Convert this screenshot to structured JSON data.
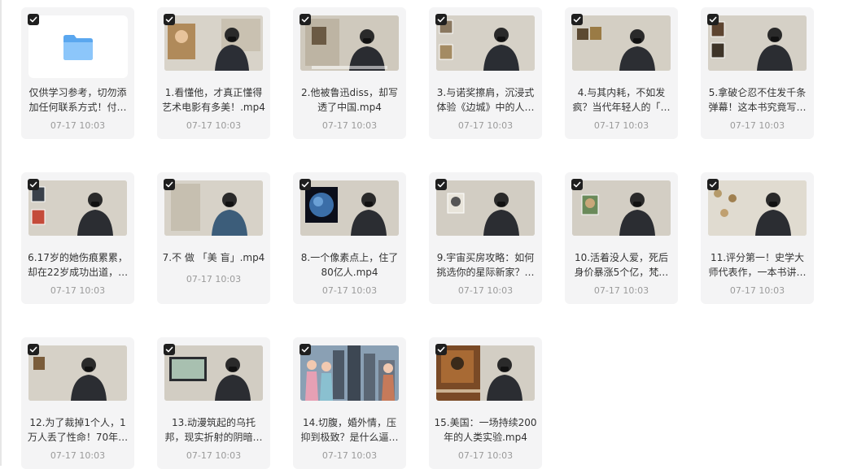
{
  "colors": {
    "card_bg": "#f4f4f5",
    "title": "#333333",
    "time": "#9a9a9a",
    "checkbox": "#1f1f1f",
    "folder": "#6db4f5"
  },
  "files": [
    {
      "kind": "folder",
      "title": "仅供学习参考，切勿添加任何联系方式！付…",
      "time": "07-17 10:03",
      "selected": true,
      "icon": "folder-icon"
    },
    {
      "kind": "video",
      "title": "1.看懂他，才真正懂得艺术电影有多美！.mp4",
      "time": "07-17 10:03",
      "selected": true
    },
    {
      "kind": "video",
      "title": "2.他被鲁迅diss，却写透了中国.mp4",
      "time": "07-17 10:03",
      "selected": true
    },
    {
      "kind": "video",
      "title": "3.与诺奖擦肩，沉浸式体验《边城》中的人…",
      "time": "07-17 10:03",
      "selected": true
    },
    {
      "kind": "video",
      "title": "4.与其内耗，不如发疯？当代年轻人的「…",
      "time": "07-17 10:03",
      "selected": true
    },
    {
      "kind": "video",
      "title": "5.拿破仑忍不住发千条弹幕！这本书究竟写…",
      "time": "07-17 10:03",
      "selected": true
    },
    {
      "kind": "video",
      "title": "6.17岁的她伤痕累累，却在22岁成功出道，…",
      "time": "07-17 10:03",
      "selected": true
    },
    {
      "kind": "video",
      "title": "7.不 做 「美 盲」.mp4",
      "time": "07-17 10:03",
      "selected": true
    },
    {
      "kind": "video",
      "title": "8.一个像素点上，住了80亿人.mp4",
      "time": "07-17 10:03",
      "selected": true
    },
    {
      "kind": "video",
      "title": "9.宇宙买房攻略：如何挑选你的星际新家？…",
      "time": "07-17 10:03",
      "selected": true
    },
    {
      "kind": "video",
      "title": "10.活着没人爱，死后身价暴涨5个亿，梵…",
      "time": "07-17 10:03",
      "selected": true
    },
    {
      "kind": "video",
      "title": "11.评分第一！史学大师代表作，一本书讲…",
      "time": "07-17 10:03",
      "selected": true
    },
    {
      "kind": "video",
      "title": "12.为了裁掉1个人，1万人丢了性命！70年…",
      "time": "07-17 10:03",
      "selected": true
    },
    {
      "kind": "video",
      "title": "13.动漫筑起的乌托邦，现实折射的阴暗…",
      "time": "07-17 10:03",
      "selected": true
    },
    {
      "kind": "video",
      "title": "14.切腹，婚外情，压抑到极致？是什么逼…",
      "time": "07-17 10:03",
      "selected": true
    },
    {
      "kind": "video",
      "title": "15.美国：一场持续200年的人类实验.mp4",
      "time": "07-17 10:03",
      "selected": true
    }
  ]
}
